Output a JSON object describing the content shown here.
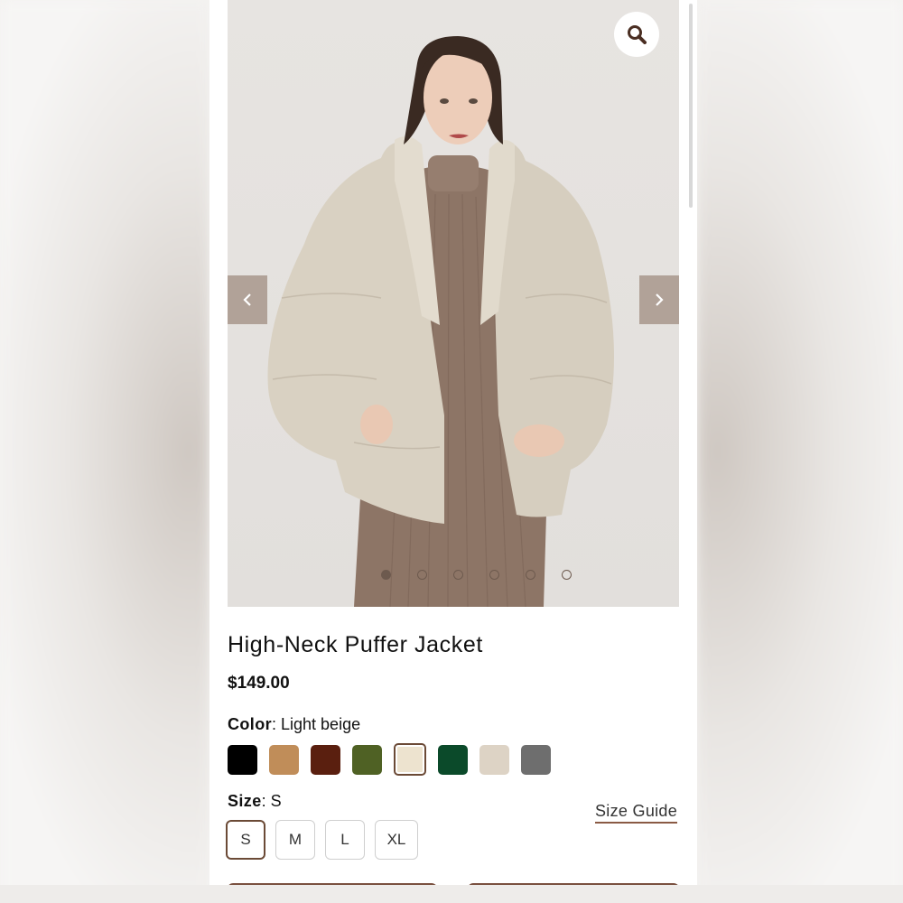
{
  "product": {
    "title": "High-Neck Puffer Jacket",
    "price": "$149.00"
  },
  "gallery": {
    "image_description_icon": "product-photo",
    "zoom_icon": "magnifier-icon",
    "prev_icon": "chevron-left-icon",
    "next_icon": "chevron-right-icon",
    "image_count": 6,
    "active_index": 0
  },
  "color": {
    "label": "Color",
    "selected": "Light beige",
    "swatches": [
      {
        "name": "black",
        "hex": "#000000",
        "selected": false
      },
      {
        "name": "camel",
        "hex": "#c08d59",
        "selected": false
      },
      {
        "name": "brown",
        "hex": "#5a1f0f",
        "selected": false
      },
      {
        "name": "olive",
        "hex": "#4f6124",
        "selected": false
      },
      {
        "name": "light beige",
        "hex": "#ede3cf",
        "selected": true
      },
      {
        "name": "green",
        "hex": "#0b4a2a",
        "selected": false
      },
      {
        "name": "sand",
        "hex": "#ddd3c5",
        "selected": false
      },
      {
        "name": "grey",
        "hex": "#6e6e6e",
        "selected": false
      }
    ]
  },
  "size": {
    "label": "Size",
    "selected": "S",
    "guide_label": "Size Guide",
    "options": [
      "S",
      "M",
      "L",
      "XL"
    ]
  },
  "colors": {
    "accent": "#6b4a36",
    "gallery_bg": "#e4e1de"
  }
}
